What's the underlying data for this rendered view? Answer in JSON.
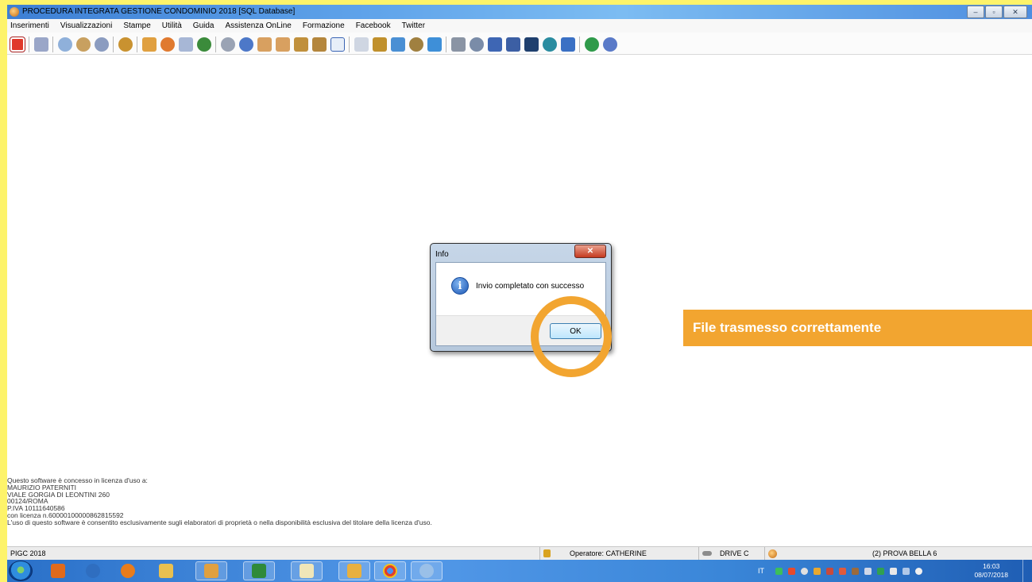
{
  "window": {
    "title": "PROCEDURA INTEGRATA GESTIONE CONDOMINIO 2018 [SQL Database]",
    "controls": [
      "–",
      "▫",
      "✕"
    ]
  },
  "menu": [
    "Inserimenti",
    "Visualizzazioni",
    "Stampe",
    "Utilità",
    "Guida",
    "Assistenza OnLine",
    "Formazione",
    "Facebook",
    "Twitter"
  ],
  "toolbar_icons": [
    "power-icon",
    "calculator-icon",
    "keys-icon",
    "keys-icon",
    "coins-icon",
    "keys-icon",
    "house-icon",
    "people-icon",
    "grid-icon",
    "people-icon",
    "pie-chart-icon",
    "pie-chart-icon",
    "hand-icon",
    "hand-icon",
    "hand-icon",
    "f24-icon",
    "document-icon",
    "tools-icon",
    "chart-icon",
    "person-icon",
    "cube-icon",
    "printer-icon",
    "disk-icon",
    "hand-icon",
    "book-icon",
    "monitor-icon",
    "globe-icon",
    "book-icon",
    "globe-icon",
    "help-icon"
  ],
  "dialog": {
    "title": "Info",
    "close": "✕",
    "message": "Invio completato con successo",
    "ok": "OK"
  },
  "banner": "File trasmesso correttamente",
  "license": [
    "Questo software è concesso in licenza d'uso a:",
    "MAURIZIO PATERNITI",
    "VIALE GORGIA DI LEONTINI 260",
    "00124/ROMA",
    "P.IVA 10111640586",
    "con licenza n.60000100000862815592",
    "L'uso di questo software è consentito esclusivamente sugli elaboratori di proprietà o nella disponibilità esclusiva del titolare della licenza d'uso."
  ],
  "status": {
    "app": "PIGC 2018",
    "operator": "Operatore: CATHERINE",
    "drive": "DRIVE C",
    "condominio": "(2) PROVA BELLA 6"
  },
  "taskbar": {
    "lang": "IT",
    "time": "16:03",
    "date": "08/07/2018"
  },
  "colors": {
    "accent": "#f2a530",
    "background": "#fdf36a",
    "taskbar": "#2a70c8"
  }
}
